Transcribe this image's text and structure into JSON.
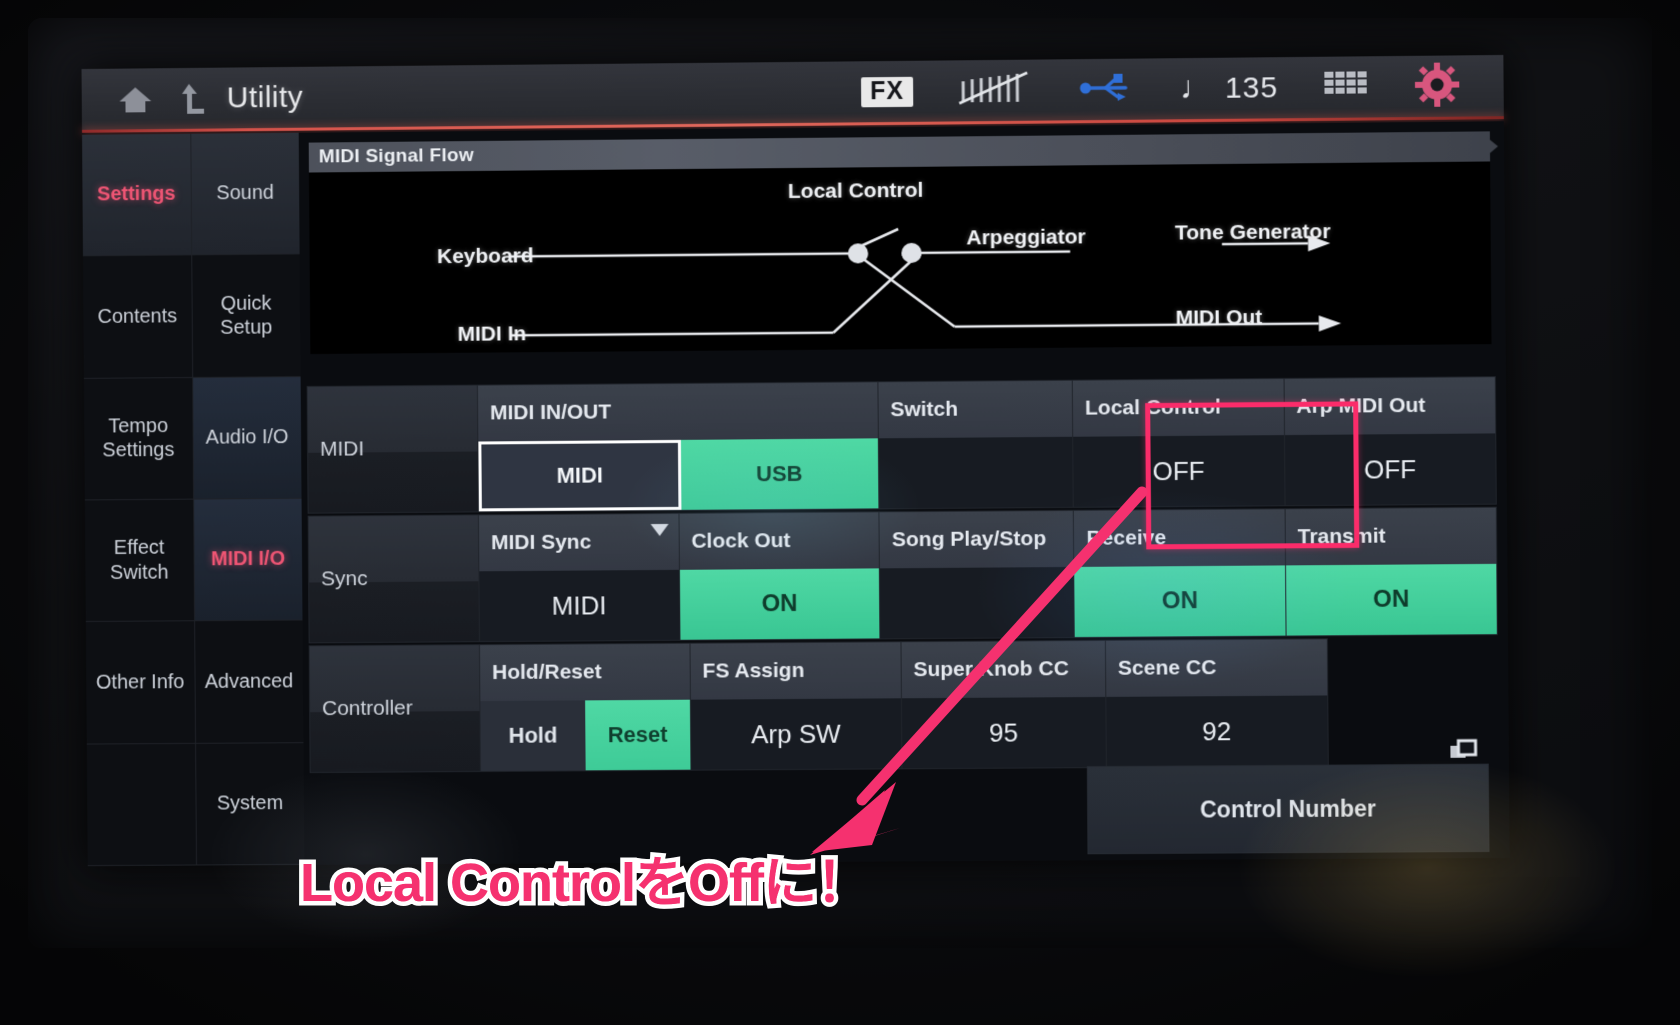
{
  "header": {
    "home_icon": "home-icon",
    "up_icon": "up-arrow-icon",
    "title": "Utility",
    "fx_badge": "FX",
    "keyboard_icon": "keyboard-slider-icon",
    "usb_icon": "usb-icon",
    "note_glyph": "♩",
    "tempo": "135",
    "grid_icon": "grid-icon",
    "gear_icon": "gear-icon"
  },
  "sidebar": {
    "rows": [
      {
        "left": "Settings",
        "right": "Sound"
      },
      {
        "left": "Contents",
        "right": "Quick\nSetup"
      },
      {
        "left": "Tempo\nSettings",
        "right": "Audio\nI/O"
      },
      {
        "left": "Effect\nSwitch",
        "right": "MIDI\nI/O"
      },
      {
        "left": "Other\nInfo",
        "right": "Advanced"
      },
      {
        "left": "",
        "right": "System"
      }
    ],
    "active_left": "Settings",
    "active_right": "MIDI I/O",
    "items": [
      {
        "label": "Settings"
      },
      {
        "label": "Sound"
      },
      {
        "label": "Contents"
      },
      {
        "label": "Quick Setup"
      },
      {
        "label": "Tempo Settings"
      },
      {
        "label": "Audio I/O"
      },
      {
        "label": "Effect Switch"
      },
      {
        "label": "MIDI I/O"
      },
      {
        "label": "Other Info"
      },
      {
        "label": "Advanced"
      },
      {
        "label": "System"
      }
    ]
  },
  "flow": {
    "title": "MIDI Signal Flow",
    "labels": {
      "keyboard": "Keyboard",
      "local_control": "Local Control",
      "arpeggiator": "Arpeggiator",
      "tone_generator": "Tone Generator",
      "midi_in": "MIDI In",
      "midi_out": "MIDI Out"
    }
  },
  "grid": {
    "rows": [
      {
        "label": "MIDI",
        "cells": [
          {
            "head": "MIDI IN/OUT",
            "type": "segments",
            "segments": [
              {
                "label": "MIDI",
                "state": "selected"
              },
              {
                "label": "USB",
                "state": "on"
              }
            ]
          },
          {
            "head": "Switch",
            "type": "empty",
            "value": ""
          },
          {
            "head": "Local Control",
            "type": "value",
            "value": "OFF",
            "highlighted": true
          },
          {
            "head": "Arp MIDI Out",
            "type": "value",
            "value": "OFF"
          }
        ]
      },
      {
        "label": "Sync",
        "cells": [
          {
            "head": "MIDI Sync",
            "type": "value",
            "value": "MIDI",
            "dropdown": true
          },
          {
            "head": "Clock Out",
            "type": "fill",
            "value": "ON"
          },
          {
            "head": "Song Play/Stop",
            "type": "empty",
            "value": ""
          },
          {
            "head": "Receive",
            "type": "fill",
            "value": "ON"
          },
          {
            "head": "Transmit",
            "type": "fill",
            "value": "ON"
          }
        ]
      },
      {
        "label": "Controller",
        "cells": [
          {
            "head": "Hold/Reset",
            "type": "segments",
            "segments": [
              {
                "label": "Hold",
                "state": "off"
              },
              {
                "label": "Reset",
                "state": "on"
              }
            ]
          },
          {
            "head": "FS Assign",
            "type": "value",
            "value": "Arp SW"
          },
          {
            "head": "Super Knob CC",
            "type": "value",
            "value": "95"
          },
          {
            "head": "Scene CC",
            "type": "value",
            "value": "92"
          }
        ]
      }
    ],
    "control_number": {
      "label": "Control Number",
      "window_icon": "overlapping-windows-icon"
    }
  },
  "annotation": {
    "caption": "Local ControlをOffに！",
    "highlight_color": "#fb2c6a",
    "arrow_color": "#f5316f",
    "arrow_target": "Local Control OFF cell"
  },
  "colors": {
    "accent_pink": "#ef5574",
    "green_on": "#4fd8a4",
    "header_rule": "#e0685c",
    "annotation_pink": "#f5316f"
  }
}
